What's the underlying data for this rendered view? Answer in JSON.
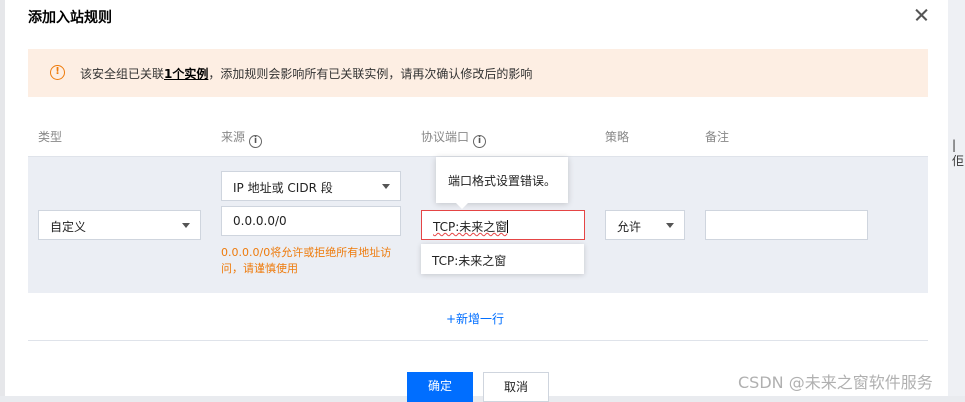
{
  "dialog": {
    "title": "添加入站规则",
    "close_icon": "close-icon"
  },
  "right_strip_text": "|佢",
  "warning": {
    "icon": "exclamation-circle-icon",
    "text_before": "该安全组已关联",
    "link": "1个实例",
    "text_after": "，添加规则会影响所有已关联实例，请再次确认修改后的影响"
  },
  "table": {
    "headers": {
      "type": "类型",
      "source": "来源",
      "port": "协议端口",
      "policy": "策略",
      "note": "备注"
    },
    "info_glyph": "i",
    "row": {
      "type_select": "自定义",
      "source_select": "IP 地址或 CIDR 段",
      "source_value": "0.0.0.0/0",
      "source_hint": "0.0.0.0/0将允许或拒绝所有地址访问，请谨慎使用",
      "port_value": "TCP:未来之窗",
      "port_error_tooltip": "端口格式设置错误。",
      "port_suggestion": "TCP:未来之窗",
      "policy_select": "允许",
      "note_value": ""
    }
  },
  "add_row_label": "+新增一行",
  "buttons": {
    "ok": "确定",
    "cancel": "取消"
  },
  "watermark": "CSDN @未来之窗软件服务",
  "colors": {
    "primary": "#006eff",
    "warning": "#ee7b0c",
    "error": "#e54545",
    "warning_bg": "#fdeee3",
    "row_bg": "#ebeef4"
  }
}
